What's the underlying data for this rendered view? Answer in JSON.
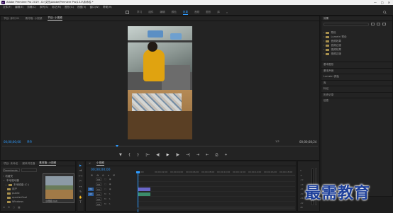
{
  "window": {
    "title": "Adobe Premiere Pro 2019 - D:\\文档\\Adobe\\Premiere Pro\\13.0\\未命名.*",
    "controls": [
      "—",
      "□",
      "✕"
    ]
  },
  "menu": [
    "文件(F)",
    "编辑(E)",
    "剪辑(C)",
    "序列(S)",
    "标记(M)",
    "图形(G)",
    "视图(V)",
    "窗口(W)",
    "帮助(H)"
  ],
  "workspaces": {
    "tabs": [
      {
        "label": "学习",
        "active": false
      },
      {
        "label": "组件",
        "active": false
      },
      {
        "label": "编辑",
        "active": false
      },
      {
        "label": "颜色",
        "active": false
      },
      {
        "label": "效果",
        "active": true
      },
      {
        "label": "音频",
        "active": false
      },
      {
        "label": "图形",
        "active": false
      },
      {
        "label": "库",
        "active": false
      }
    ],
    "more": "»"
  },
  "monitor": {
    "tabs": [
      {
        "label": "节目: 序列 01",
        "active": false
      },
      {
        "label": "素材箱: 小视频",
        "active": false
      },
      {
        "label": "节目: 小视频",
        "active": true
      }
    ],
    "timecode_left": "00;00;00;00",
    "fit": "适合",
    "quality": "1/2",
    "timecode_right": "00;00;08;24",
    "transport": [
      "▼",
      "{",
      "}",
      "|←",
      "◀|",
      "▶",
      "|▶",
      "→|",
      "⇥",
      "⇤",
      "⎙",
      "+"
    ]
  },
  "effects": {
    "title": "效果",
    "tree": [
      "预设",
      "Lumetri 预设",
      "音频效果",
      "音频过渡",
      "视频效果",
      "视频过渡"
    ],
    "sections": [
      "基本图形",
      "基本声音",
      "Lumetri 颜色",
      "库",
      "标记",
      "历史记录",
      "信息"
    ]
  },
  "project": {
    "tabs": [
      {
        "label": "项目: 未命名",
        "active": false
      },
      {
        "label": "媒体浏览器",
        "active": false
      },
      {
        "label": "素材箱: 小视频",
        "active": true
      }
    ],
    "location": "Downloads",
    "tree": [
      "收藏夹",
      "本地驱动器",
      "本地磁盘 (C:)",
      "用户",
      "public",
      "quarterfinal",
      "Windows"
    ],
    "thumbnail_label": "小视频.mp4",
    "bottom_icons": [
      "≡",
      "⊟",
      "○",
      "▦"
    ]
  },
  "tools": [
    "▶",
    "⇉",
    "⟷",
    "✂",
    "↔",
    "✎",
    "✋",
    "T"
  ],
  "timeline": {
    "tab": "小视频",
    "timecode": "00;00;00;00",
    "ruler": [
      "00;00",
      "00;00;02;00",
      "00;00;04;00",
      "00;00;06;00",
      "00;00;08;00",
      "00;00;10;00",
      "00;00;12;00",
      "00;00;14;00",
      "00;00;16;00",
      "00;00;18;00"
    ],
    "tracks": [
      {
        "src": "",
        "name": "V3"
      },
      {
        "src": "",
        "name": "V2"
      },
      {
        "src": "V1",
        "name": "V1"
      },
      {
        "src": "A1",
        "name": "A1"
      },
      {
        "src": "",
        "name": "A2"
      },
      {
        "src": "",
        "name": "A3"
      },
      {
        "src": "",
        "name": "主声道"
      }
    ]
  },
  "meters": {
    "scale": [
      "0",
      "-6",
      "-12",
      "-18",
      "-24",
      "-30",
      "-36",
      "-42",
      "dB"
    ]
  },
  "watermark": "最需教育",
  "colors": {
    "accent": "#2e9bff",
    "video_clip": "#6a66c8",
    "audio_clip": "#3b8c6a"
  }
}
